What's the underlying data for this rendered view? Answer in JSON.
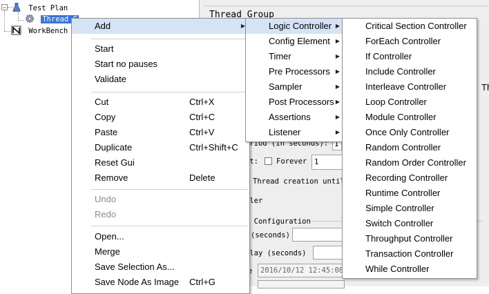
{
  "tree": {
    "test_plan": "Test Plan",
    "thread_group": "Thread G",
    "workbench": "WorkBench"
  },
  "panel": {
    "title": "Thread Group",
    "period_label": "eriod (in seconds):",
    "period_value": "1",
    "loop_label": "at:",
    "forever_label": "Forever",
    "loop_value": "1",
    "delay_creation": "Thread creation until",
    "scheduler": "uler",
    "scheduler_config": "r Configuration",
    "duration": "(seconds)",
    "startup_delay": "elay (seconds)",
    "start_time_label": "e",
    "start_time_value": "2016/10/12 12:45:08",
    "right_edge_text": "Th"
  },
  "context_menu": {
    "items": [
      {
        "label": "Add",
        "accel": "",
        "submenu": true,
        "disabled": false
      },
      {
        "label": "Start",
        "accel": "",
        "submenu": false,
        "disabled": false
      },
      {
        "label": "Start no pauses",
        "accel": "",
        "submenu": false,
        "disabled": false
      },
      {
        "label": "Validate",
        "accel": "",
        "submenu": false,
        "disabled": false
      },
      {
        "label": "Cut",
        "accel": "Ctrl+X",
        "submenu": false,
        "disabled": false
      },
      {
        "label": "Copy",
        "accel": "Ctrl+C",
        "submenu": false,
        "disabled": false
      },
      {
        "label": "Paste",
        "accel": "Ctrl+V",
        "submenu": false,
        "disabled": false
      },
      {
        "label": "Duplicate",
        "accel": "Ctrl+Shift+C",
        "submenu": false,
        "disabled": false
      },
      {
        "label": "Reset Gui",
        "accel": "",
        "submenu": false,
        "disabled": false
      },
      {
        "label": "Remove",
        "accel": "Delete",
        "submenu": false,
        "disabled": false
      },
      {
        "label": "Undo",
        "accel": "",
        "submenu": false,
        "disabled": true
      },
      {
        "label": "Redo",
        "accel": "",
        "submenu": false,
        "disabled": true
      },
      {
        "label": "Open...",
        "accel": "",
        "submenu": false,
        "disabled": false
      },
      {
        "label": "Merge",
        "accel": "",
        "submenu": false,
        "disabled": false
      },
      {
        "label": "Save Selection As...",
        "accel": "",
        "submenu": false,
        "disabled": false
      },
      {
        "label": "Save Node As Image",
        "accel": "Ctrl+G",
        "submenu": false,
        "disabled": false
      }
    ]
  },
  "add_submenu": {
    "items": [
      {
        "label": "Logic Controller"
      },
      {
        "label": "Config Element"
      },
      {
        "label": "Timer"
      },
      {
        "label": "Pre Processors"
      },
      {
        "label": "Sampler"
      },
      {
        "label": "Post Processors"
      },
      {
        "label": "Assertions"
      },
      {
        "label": "Listener"
      }
    ]
  },
  "logic_controller_submenu": {
    "items": [
      {
        "label": "Critical Section Controller"
      },
      {
        "label": "ForEach Controller"
      },
      {
        "label": "If Controller"
      },
      {
        "label": "Include Controller"
      },
      {
        "label": "Interleave Controller"
      },
      {
        "label": "Loop Controller"
      },
      {
        "label": "Module Controller"
      },
      {
        "label": "Once Only Controller"
      },
      {
        "label": "Random Controller"
      },
      {
        "label": "Random Order Controller"
      },
      {
        "label": "Recording Controller"
      },
      {
        "label": "Runtime Controller"
      },
      {
        "label": "Simple Controller"
      },
      {
        "label": "Switch Controller"
      },
      {
        "label": "Throughput Controller"
      },
      {
        "label": "Transaction Controller"
      },
      {
        "label": "While Controller"
      }
    ]
  },
  "colors": {
    "selection": "#3875d7",
    "menu_highlight": "#d5e3f5",
    "disabled_text": "#8c8c8c"
  }
}
